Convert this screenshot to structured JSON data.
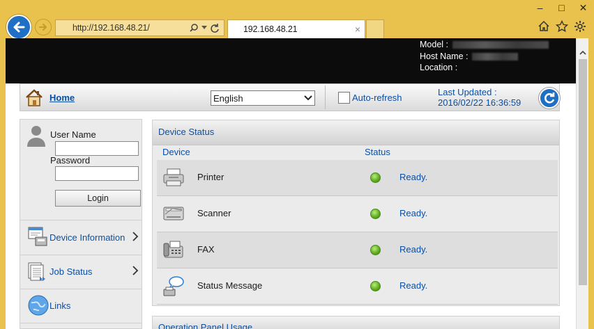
{
  "browser": {
    "url": "http://192.168.48.21/",
    "tab_title": "192.168.48.21",
    "window_buttons": [
      "–",
      "□",
      "✕"
    ],
    "icons": [
      "back-arrow-icon",
      "forward-arrow-icon",
      "search-icon",
      "refresh-icon",
      "close-icon",
      "home-icon",
      "star-icon",
      "gear-icon"
    ]
  },
  "device_info": {
    "model_label": "Model :",
    "host_label": "Host Name :",
    "location_label": "Location :"
  },
  "toolbar": {
    "home_label": "Home",
    "language": "English",
    "auto_refresh_label": "Auto-refresh",
    "auto_refresh_checked": false,
    "last_updated_label": "Last Updated :",
    "last_updated_value": "2016/02/22 16:36:59"
  },
  "login": {
    "username_label": "User Name",
    "password_label": "Password",
    "username_value": "",
    "password_value": "",
    "login_button": "Login"
  },
  "sidebar": {
    "items": [
      {
        "label": "Device Information",
        "icon": "device-info-icon",
        "has_submenu": true
      },
      {
        "label": "Job Status",
        "icon": "job-status-icon",
        "has_submenu": true
      },
      {
        "label": "Links",
        "icon": "globe-icon",
        "has_submenu": false
      }
    ]
  },
  "device_status": {
    "title": "Device Status",
    "col_device": "Device",
    "col_status": "Status",
    "rows": [
      {
        "device": "Printer",
        "status": "Ready.",
        "icon": "printer-icon",
        "status_color": "#5da81d"
      },
      {
        "device": "Scanner",
        "status": "Ready.",
        "icon": "scanner-icon",
        "status_color": "#5da81d"
      },
      {
        "device": "FAX",
        "status": "Ready.",
        "icon": "fax-icon",
        "status_color": "#5da81d"
      },
      {
        "device": "Status Message",
        "status": "Ready.",
        "icon": "status-message-icon",
        "status_color": "#5da81d"
      }
    ]
  },
  "operation_panel": {
    "title": "Operation Panel Usage"
  },
  "colors": {
    "chrome": "#e9c24d",
    "link": "#0b4fa3",
    "accent": "#1f6fc4",
    "header_band": "#0c0c0c"
  }
}
